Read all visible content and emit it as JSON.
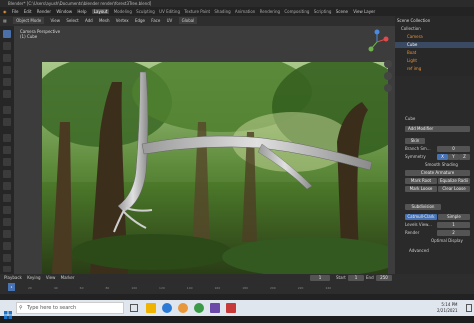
{
  "window": {
    "title": "Blender* [C:\\Users\\ayush\\Documents\\blender render\\forest3Tree.blend]"
  },
  "menu": {
    "items": [
      "File",
      "Edit",
      "Render",
      "Window",
      "Help"
    ],
    "workspaces": [
      "Layout",
      "Modeling",
      "Sculpting",
      "UV Editing",
      "Texture Paint",
      "Shading",
      "Animation",
      "Rendering",
      "Compositing",
      "Scripting"
    ],
    "active_workspace": "Layout",
    "scene": "Scene",
    "view_layer": "View Layer"
  },
  "header": {
    "mode": "Object Mode",
    "items": [
      "View",
      "Select",
      "Add",
      "Mesh",
      "Vertex",
      "Edge",
      "Face",
      "UV"
    ],
    "orientation": "Global"
  },
  "viewport": {
    "perspective": "Camera Perspective",
    "object": "(1) Cube"
  },
  "outliner": {
    "title": "Scene Collection",
    "items": [
      {
        "name": "Collection"
      },
      {
        "name": "Camera"
      },
      {
        "name": "Cube"
      },
      {
        "name": "Boat"
      },
      {
        "name": "Light"
      },
      {
        "name": "ref img"
      }
    ]
  },
  "properties": {
    "object_name": "Cube",
    "add_modifier": "Add Modifier",
    "modifier1_name": "Skin",
    "branch_smoothing_label": "Branch Sm...",
    "branch_smoothing_value": "0",
    "symmetry_label": "Symmetry",
    "symmetry_axes": [
      "X",
      "Y",
      "Z"
    ],
    "smooth_shading": "Smooth Shading",
    "create_armature": "Create Armature",
    "mark_root": "Mark Root",
    "equalize_radii": "Equalize Radii",
    "mark_loose": "Mark Loose",
    "clear_loose": "Clear Loose",
    "modifier2_name": "Subdivision",
    "catmull_clark": "Catmull-Clark",
    "simple": "Simple",
    "levels_viewport_label": "Levels View...",
    "levels_viewport_value": "1",
    "render_label": "Render",
    "render_value": "2",
    "optimal_display": "Optimal Display",
    "advanced": "Advanced"
  },
  "timeline": {
    "menu": [
      "Playback",
      "Keying",
      "View",
      "Marker"
    ],
    "current_frame": "1",
    "start_label": "Start",
    "start": "1",
    "end_label": "End",
    "end": "250",
    "ticks": [
      "20",
      "40",
      "60",
      "80",
      "100",
      "120",
      "140",
      "160",
      "180",
      "200",
      "220",
      "240"
    ]
  },
  "taskbar": {
    "search_placeholder": "Type here to search",
    "time": "5:14 PM",
    "date": "2/21/2021"
  },
  "colors": {
    "accent": "#4772b3",
    "orange": "#e8973a"
  }
}
